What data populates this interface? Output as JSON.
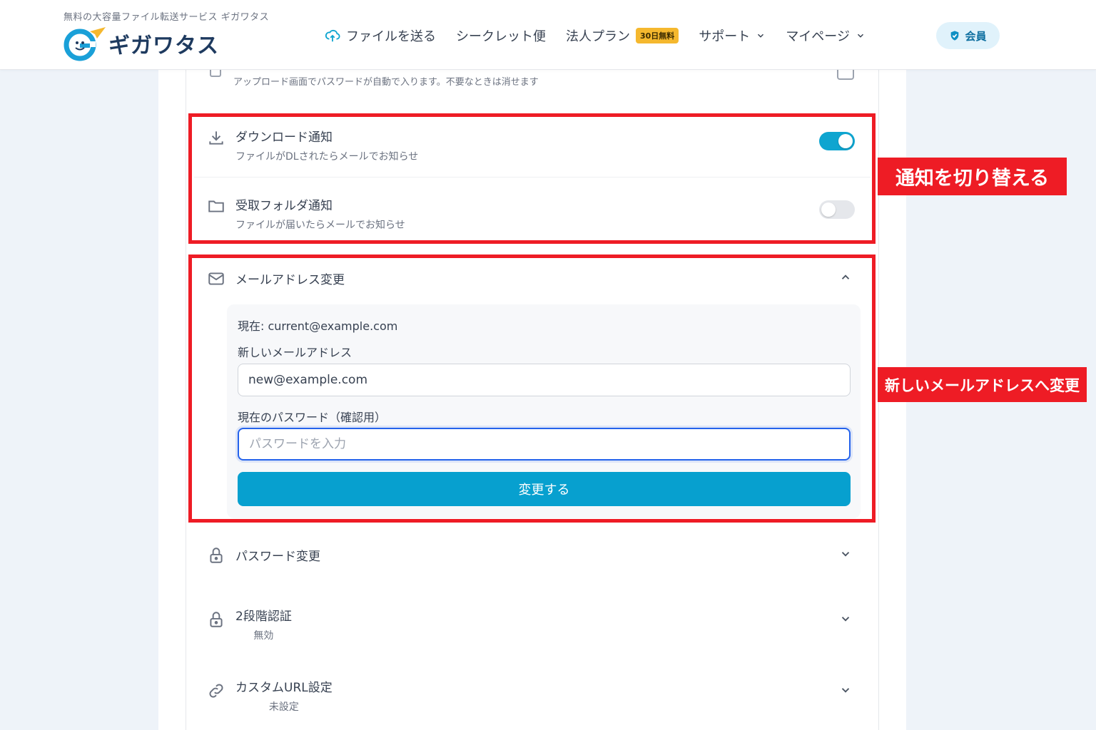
{
  "header": {
    "tagline": "無料の大容量ファイル転送サービス ギガワタス",
    "logo_text": "ギガワタス",
    "nav": [
      {
        "label": "ファイルを送る"
      },
      {
        "label": "シークレット便"
      },
      {
        "label": "法人プラン",
        "badge": "30日無料"
      },
      {
        "label": "サポート"
      },
      {
        "label": "マイページ"
      }
    ],
    "member_label": "会員"
  },
  "settings": {
    "top_partial_sub": "アップロード画面でパスワードが自動で入ります。不要なときは消せます",
    "download_notice": {
      "title": "ダウンロード通知",
      "sub": "ファイルがDLされたらメールでお知らせ",
      "enabled": true
    },
    "folder_notice": {
      "title": "受取フォルダ通知",
      "sub": "ファイルが届いたらメールでお知らせ",
      "enabled": false
    },
    "email_change": {
      "title": "メールアドレス変更",
      "current": "現在: current@example.com",
      "new_label": "新しいメールアドレス",
      "new_value": "new@example.com",
      "password_label": "現在のパスワード（確認用）",
      "password_placeholder": "パスワードを入力",
      "submit_label": "変更する"
    },
    "password_change": {
      "title": "パスワード変更"
    },
    "two_factor": {
      "title": "2段階認証",
      "status": "無効"
    },
    "custom_url": {
      "title": "カスタムURL設定",
      "status": "未設定"
    }
  },
  "annotations": {
    "toggle_note": "通知を切り替える",
    "email_note": "新しいメールアドレスへ変更",
    "color": "#ee1c25"
  },
  "colors": {
    "accent": "#07a0cf",
    "toggle_on": "#0ea5d0",
    "brand": "#1e3a5f"
  }
}
